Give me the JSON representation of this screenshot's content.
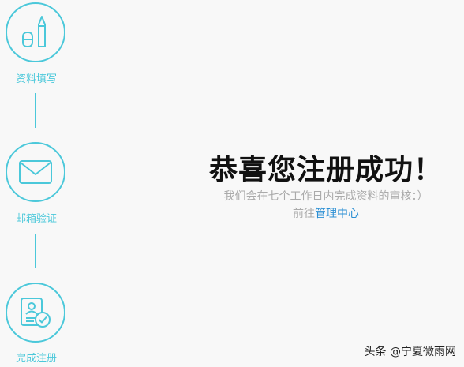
{
  "steps": [
    {
      "label": "资料填写",
      "icon": "fill-info-icon"
    },
    {
      "label": "邮箱验证",
      "icon": "mail-icon"
    },
    {
      "label": "完成注册",
      "icon": "id-card-check-icon"
    }
  ],
  "main": {
    "title": "恭喜您注册成功！",
    "subtitle": "我们会在七个工作日内完成资料的审核：）",
    "goto_prefix": "前往",
    "goto_link": "管理中心"
  },
  "watermark": "头条 @宁夏微雨网",
  "colors": {
    "accent": "#4bc8da",
    "link": "#2b8fd4",
    "muted": "#aaaaaa"
  }
}
